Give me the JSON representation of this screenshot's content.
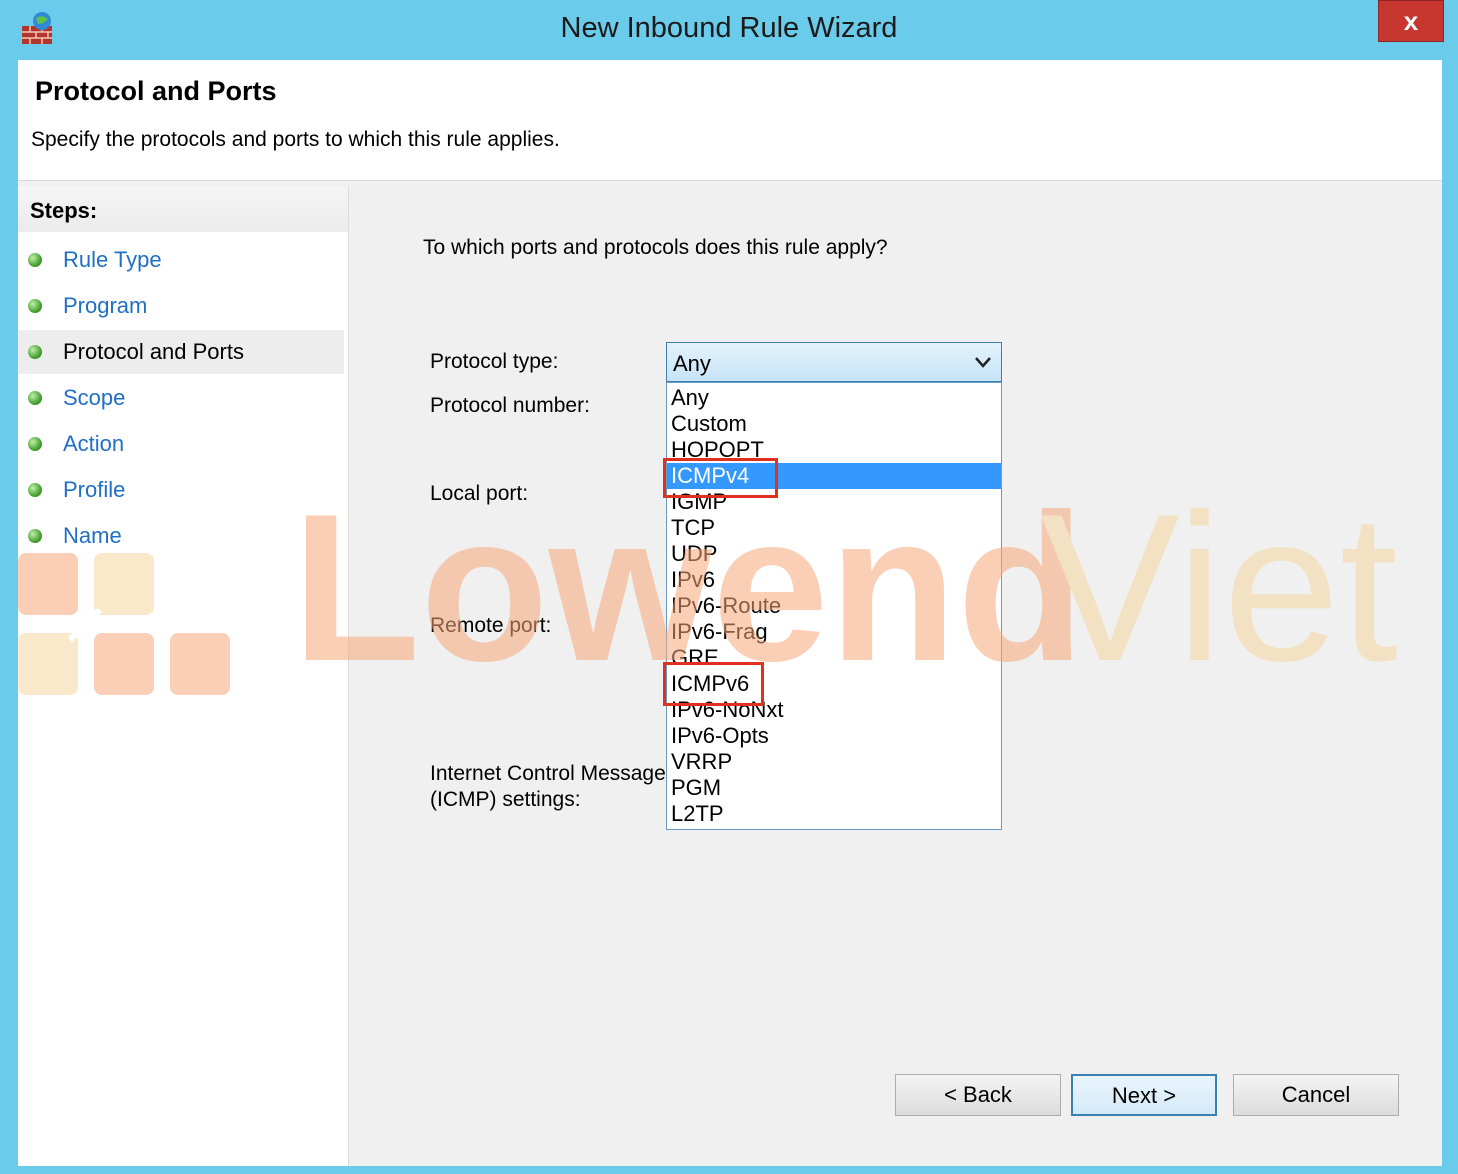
{
  "window": {
    "title": "New Inbound Rule Wizard",
    "close_label": "x"
  },
  "header": {
    "title": "Protocol and Ports",
    "subtitle": "Specify the protocols and ports to which this rule applies."
  },
  "steps": {
    "title": "Steps:",
    "items": [
      {
        "label": "Rule Type"
      },
      {
        "label": "Program"
      },
      {
        "label": "Protocol and Ports"
      },
      {
        "label": "Scope"
      },
      {
        "label": "Action"
      },
      {
        "label": "Profile"
      },
      {
        "label": "Name"
      }
    ],
    "current_index": 2
  },
  "content": {
    "question": "To which ports and protocols does this rule apply?",
    "labels": {
      "protocol_type": "Protocol type:",
      "protocol_number": "Protocol number:",
      "local_port": "Local port:",
      "remote_port": "Remote port:",
      "icmp_line1": "Internet Control Message",
      "icmp_line2": "(ICMP) settings:"
    },
    "protocol_type": {
      "selected": "Any",
      "options": [
        "Any",
        "Custom",
        "HOPOPT",
        "ICMPv4",
        "IGMP",
        "TCP",
        "UDP",
        "IPv6",
        "IPv6-Route",
        "IPv6-Frag",
        "GRE",
        "ICMPv6",
        "IPv6-NoNxt",
        "IPv6-Opts",
        "VRRP",
        "PGM",
        "L2TP"
      ],
      "hover_option": "ICMPv4",
      "highlighted_options": [
        "ICMPv4",
        "ICMPv6"
      ]
    }
  },
  "buttons": {
    "back": "< Back",
    "next": "Next >",
    "cancel": "Cancel"
  },
  "watermark": {
    "text_left": "Lowend",
    "text_right": "Viet"
  },
  "colors": {
    "titlebar": "#6bcbeb",
    "link": "#1f6fc5",
    "selection": "#3399ff",
    "annotation": "#e0311f",
    "watermark_orange": "#f7a87a",
    "watermark_yellow": "#f5d7a0"
  }
}
